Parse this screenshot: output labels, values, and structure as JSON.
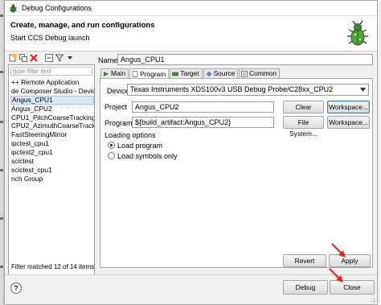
{
  "window": {
    "title": "Debug Configurations"
  },
  "banner": {
    "title": "Create, manage, and run configurations",
    "subtitle": "Start CCS Debug launch",
    "icon": "bug-icon"
  },
  "toolbar": {
    "icons": [
      "new-launch-config-icon",
      "duplicate-icon",
      "delete-icon",
      "collapse-all-icon",
      "filter-icon",
      "dropdown-icon"
    ]
  },
  "sidebar": {
    "filter_placeholder": "type filter text",
    "items": [
      "++ Remote Application",
      "de Composer Studio - Device",
      "Angus_CPU1",
      "Angus_CPU2",
      "CPU1_PitchCoarseTracking",
      "CPU2_AzimuthCoarseTracking",
      "FastSteeringMirror",
      "ipctest_cpu1",
      "ipctest2_cpu1",
      "scictest",
      "scictest_cpu1",
      "nch Group"
    ],
    "selected_index": 2,
    "filter_status": "Filter matched 12 of 14 items"
  },
  "config": {
    "name_label": "Name:",
    "name_value": "Angus_CPU1",
    "tabs": [
      "Main",
      "Program",
      "Target",
      "Source",
      "Common"
    ],
    "active_tab": "Program",
    "device_label": "Device",
    "device_value": "Texas Instruments XDS100v3 USB Debug Probe/C28xx_CPU2",
    "project_label": "Project",
    "project_value": "Angus_CPU2",
    "clear_label": "Clear",
    "workspace_label_1": "Workspace...",
    "program_label": "Program",
    "program_value": "${build_artifact:Angus_CPU2}",
    "filesystem_label": "File System...",
    "workspace_label_2": "Workspace...",
    "loading_label": "Loading options",
    "load_program_label": "Load program",
    "load_symbols_label": "Load symbols only",
    "load_option_selected": "Load program"
  },
  "actions": {
    "revert_label": "Revert",
    "apply_label": "Apply",
    "debug_label": "Debug",
    "close_label": "Close"
  },
  "annotations": {
    "arrow_color": "#e1251b"
  }
}
